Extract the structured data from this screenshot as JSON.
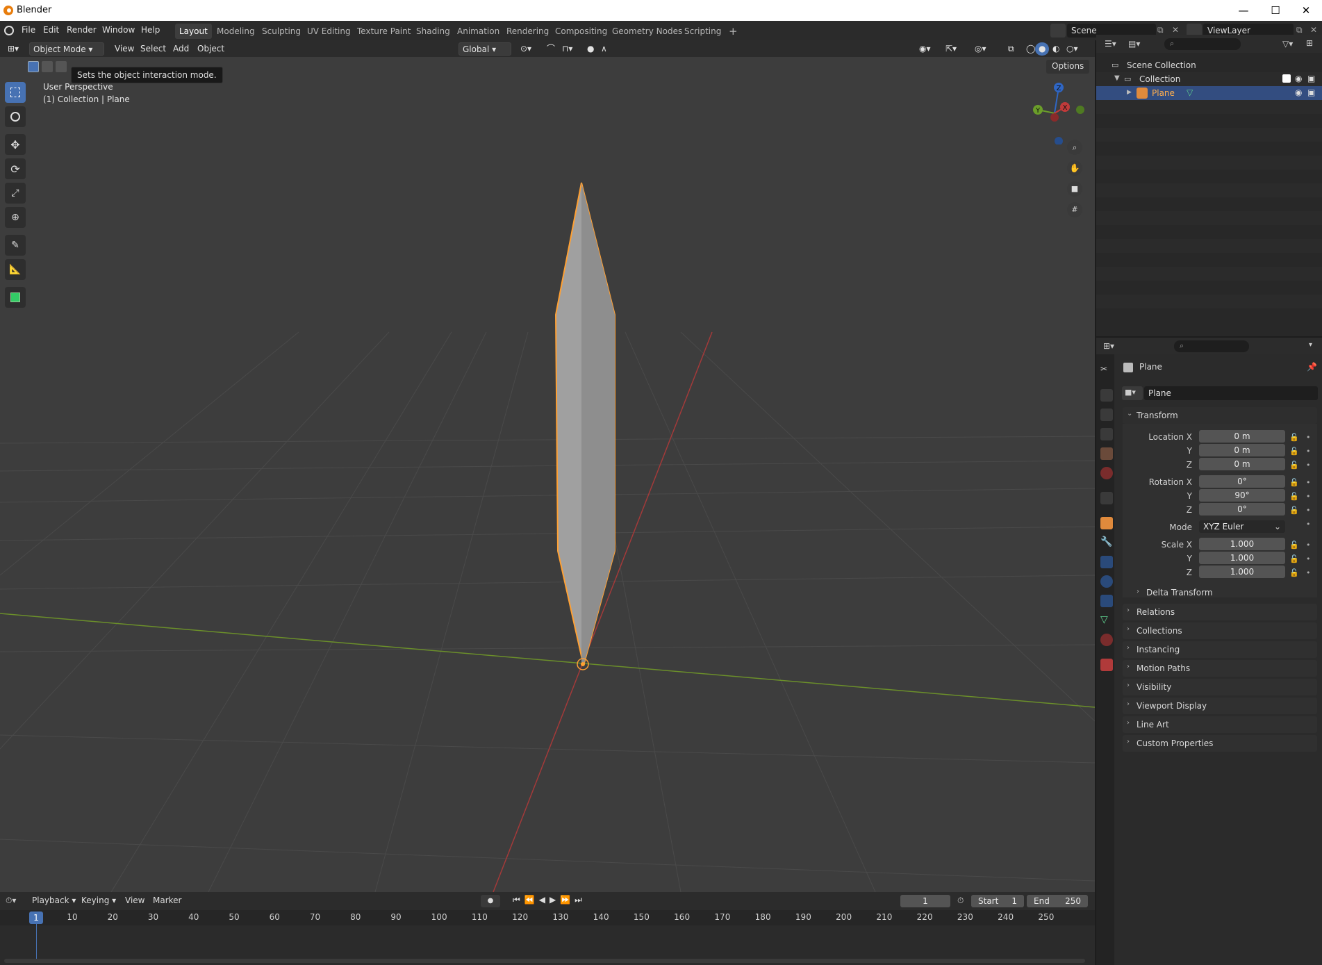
{
  "window": {
    "title": "Blender",
    "controls": [
      "—",
      "☐",
      "✕"
    ]
  },
  "menu": [
    "File",
    "Edit",
    "Render",
    "Window",
    "Help"
  ],
  "workspaces": [
    {
      "label": "Layout",
      "active": true
    },
    {
      "label": "Modeling"
    },
    {
      "label": "Sculpting"
    },
    {
      "label": "UV Editing"
    },
    {
      "label": "Texture Paint"
    },
    {
      "label": "Shading"
    },
    {
      "label": "Animation"
    },
    {
      "label": "Rendering"
    },
    {
      "label": "Compositing"
    },
    {
      "label": "Geometry Nodes"
    },
    {
      "label": "Scripting"
    }
  ],
  "add_workspace": "+",
  "scene": {
    "name": "Scene",
    "view_layer": "ViewLayer"
  },
  "viewport_header": {
    "mode": "Object Mode",
    "menus": [
      "View",
      "Select",
      "Add",
      "Object"
    ],
    "orientation": "Global",
    "options": "Options"
  },
  "tooltip": "Sets the object interaction mode.",
  "viewport_info": {
    "line1": "User Perspective",
    "line2": "(1) Collection | Plane"
  },
  "gizmo": {
    "x": "X",
    "y": "Y",
    "z": "Z"
  },
  "outliner": {
    "scene_collection": "Scene Collection",
    "collection": "Collection",
    "object": "Plane"
  },
  "properties": {
    "object_name": "Plane",
    "datablock_name": "Plane",
    "transform": {
      "title": "Transform",
      "location_label": "Location X",
      "rotation_label": "Rotation X",
      "scale_label": "Scale X",
      "y_label": "Y",
      "z_label": "Z",
      "location": [
        "0 m",
        "0 m",
        "0 m"
      ],
      "rotation": [
        "0°",
        "90°",
        "0°"
      ],
      "mode_label": "Mode",
      "mode": "XYZ Euler",
      "scale": [
        "1.000",
        "1.000",
        "1.000"
      ],
      "delta": "Delta Transform"
    },
    "panels": [
      "Relations",
      "Collections",
      "Instancing",
      "Motion Paths",
      "Visibility",
      "Viewport Display",
      "Line Art",
      "Custom Properties"
    ]
  },
  "timeline": {
    "menus": [
      "Playback",
      "Keying",
      "View",
      "Marker"
    ],
    "current_frame": "1",
    "start_label": "Start",
    "start": "1",
    "end_label": "End",
    "end": "250",
    "ticks": [
      "1",
      "10",
      "20",
      "30",
      "40",
      "50",
      "60",
      "70",
      "80",
      "90",
      "100",
      "110",
      "120",
      "130",
      "140",
      "150",
      "160",
      "170",
      "180",
      "190",
      "200",
      "210",
      "220",
      "230",
      "240",
      "250"
    ]
  },
  "colors": {
    "accent": "#4772b3",
    "selection": "#ffa033",
    "x_axis": "#a33a3a",
    "y_axis": "#6b8f2a"
  }
}
